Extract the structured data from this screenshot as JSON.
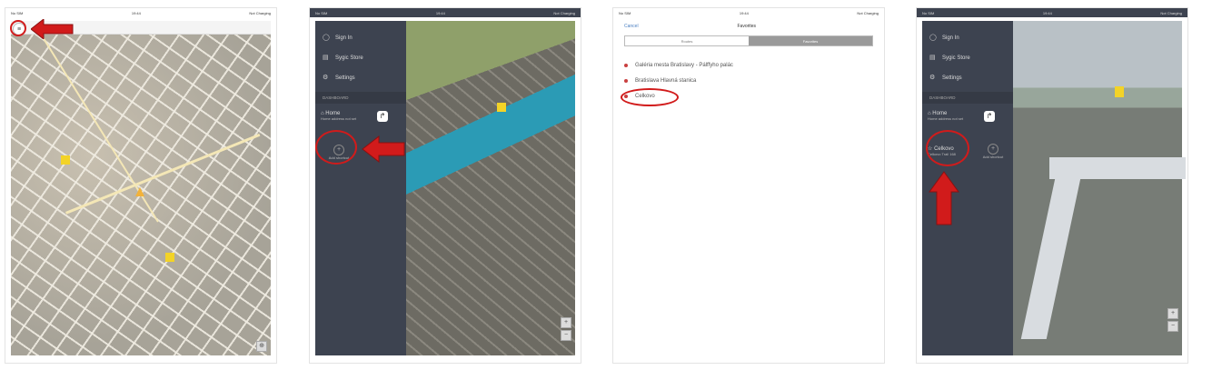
{
  "panel1": {
    "status_left": "No SIM",
    "status_center": "19:44",
    "status_right": "Not Charging",
    "menu_icon": "hamburger-icon"
  },
  "panel2": {
    "status_left": "No SIM",
    "status_center": "19:44",
    "status_right": "Not Charging",
    "menu": [
      {
        "icon": "user-icon",
        "label": "Sign In"
      },
      {
        "icon": "store-icon",
        "label": "Sygic Store"
      },
      {
        "icon": "gear-icon",
        "label": "Settings"
      }
    ],
    "section": "DASHBOARD",
    "home_label": "Home",
    "home_sub": "Home address not set",
    "add_label": "Add shortcut"
  },
  "panel3": {
    "status_left": "No SIM",
    "status_center": "19:44",
    "status_right": "Not Charging",
    "cancel": "Cancel",
    "title": "Favorites",
    "segments": [
      "Routes",
      "Favorites"
    ],
    "favorites": [
      "Galéria mesta Bratislavy - Pálffyho palác",
      "Bratislava Hlavná stanica",
      "Celkovo"
    ]
  },
  "panel4": {
    "status_left": "No SIM",
    "status_center": "19:44",
    "status_right": "Not Charging",
    "menu": [
      {
        "icon": "user-icon",
        "label": "Sign In"
      },
      {
        "icon": "store-icon",
        "label": "Sygic Store"
      },
      {
        "icon": "gear-icon",
        "label": "Settings"
      }
    ],
    "section": "DASHBOARD",
    "home_label": "Home",
    "home_sub": "Home address not set",
    "fav_label": "Celkovo",
    "fav_sub": "Celkovo Trail 168",
    "add_label": "Add shortcut"
  },
  "colors": {
    "highlight": "#d11b1b",
    "sidebar": "#3d4350",
    "accent": "#4a7fc1"
  }
}
